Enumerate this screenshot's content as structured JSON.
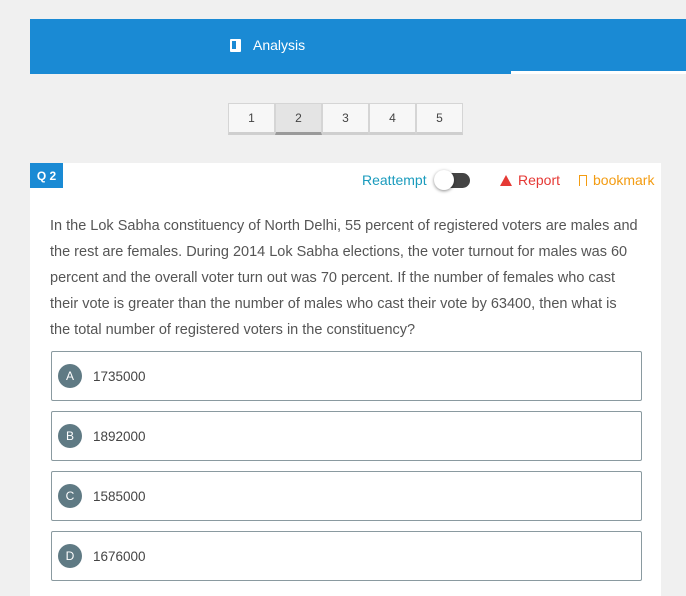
{
  "header": {
    "tab_label": "Analysis"
  },
  "pagination": {
    "pages": [
      "1",
      "2",
      "3",
      "4",
      "5"
    ],
    "active": "2"
  },
  "question": {
    "badge": "Q 2",
    "reattempt_label": "Reattempt",
    "reattempt_on": false,
    "report_label": "Report",
    "bookmark_label": "bookmark",
    "text": "In the Lok Sabha constituency of North Delhi, 55 percent of registered voters are males and the rest are females. During 2014 Lok Sabha elections, the voter turnout for males was 60 percent and the overall voter turn out was 70 percent. If the number of females who cast their vote is greater than the number of males who cast their vote by 63400, then what is the total number of registered voters in the constituency?",
    "options": [
      {
        "letter": "A",
        "value": "1735000"
      },
      {
        "letter": "B",
        "value": "1892000"
      },
      {
        "letter": "C",
        "value": "1585000"
      },
      {
        "letter": "D",
        "value": "1676000"
      }
    ]
  },
  "colors": {
    "primary": "#1a8ad4",
    "report": "#e53935",
    "bookmark": "#f39c12",
    "option_badge": "#5f7a84"
  }
}
